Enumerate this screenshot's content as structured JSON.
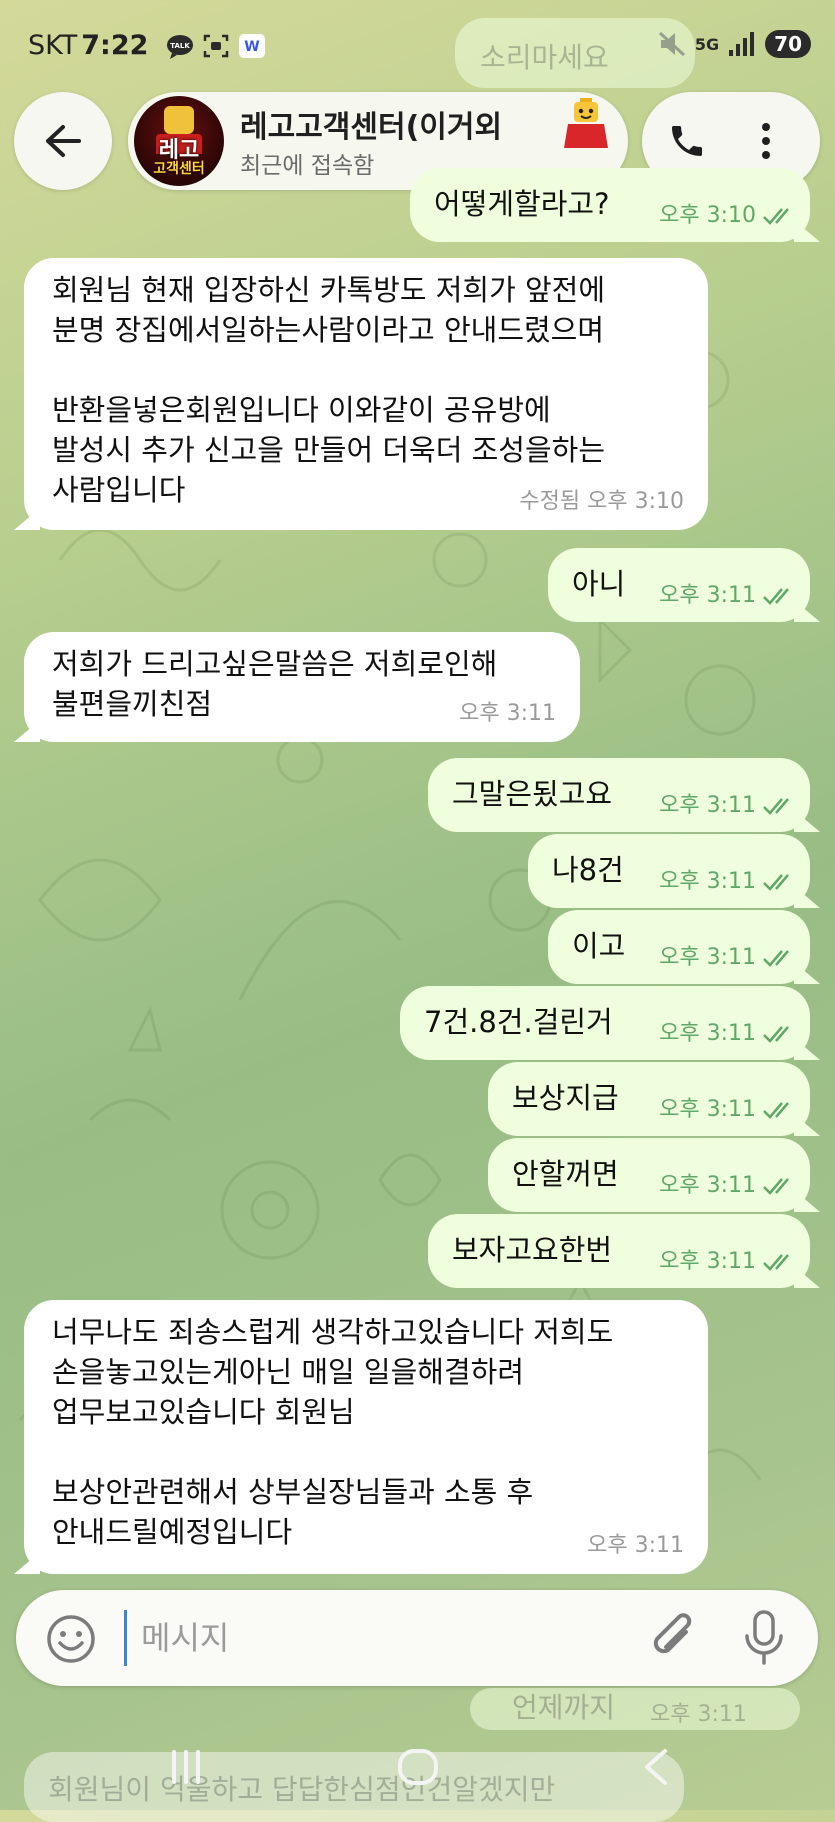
{
  "status_bar": {
    "carrier": "SKT",
    "time": "7:22",
    "network": "5G",
    "battery": "70",
    "icons": [
      "talk-icon",
      "screenshot-icon",
      "app-w-icon",
      "mute-icon",
      "signal-icon"
    ]
  },
  "header": {
    "title": "레고고객센터(이거외",
    "subtitle": "최근에 접속함",
    "avatar_line1": "레고",
    "avatar_line2": "고객센터"
  },
  "background_overlays": {
    "top_faded_text": "소리마세요",
    "bottom_faded_text1": "언제까지",
    "bottom_faded_time": "오후 3:11",
    "bottom_faded_text2": "회원님이 억울하고 답답한심점인건알겠지만"
  },
  "messages": [
    {
      "direction": "out",
      "text": "어떻게할라고?",
      "time": "오후 3:10"
    },
    {
      "direction": "in",
      "text": "회원님 현재 입장하신 카톡방도 저희가 앞전에\n분명 장집에서일하는사람이라고 안내드렸으며\n\n반환을넣은회원입니다 이와같이 공유방에\n발성시 추가 신고을 만들어 더욱더 조성을하는\n사람입니다",
      "time": "수정됨 오후 3:10"
    },
    {
      "direction": "out",
      "text": "아니",
      "time": "오후 3:11"
    },
    {
      "direction": "in",
      "text": "저희가 드리고싶은말씀은 저희로인해\n불편을끼친점",
      "time": "오후 3:11"
    },
    {
      "direction": "out",
      "text": "그말은됬고요",
      "time": "오후 3:11"
    },
    {
      "direction": "out",
      "text": "나8건",
      "time": "오후 3:11"
    },
    {
      "direction": "out",
      "text": "이고",
      "time": "오후 3:11"
    },
    {
      "direction": "out",
      "text": "7건.8건.걸린거",
      "time": "오후 3:11"
    },
    {
      "direction": "out",
      "text": "보상지급",
      "time": "오후 3:11"
    },
    {
      "direction": "out",
      "text": "안할꺼면",
      "time": "오후 3:11"
    },
    {
      "direction": "out",
      "text": "보자고요한번",
      "time": "오후 3:11"
    },
    {
      "direction": "in",
      "text": "너무나도 죄송스럽게 생각하고있습니다 저희도\n손을놓고있는게아닌 매일 일을해결하려\n업무보고있습니다 회원님\n\n보상안관련해서 상부실장님들과 소통 후\n안내드릴예정입니다",
      "time": "오후 3:11"
    }
  ],
  "input": {
    "placeholder": "메시지",
    "value": ""
  },
  "colors": {
    "outgoing_bubble": "#effedd",
    "incoming_bubble": "#ffffff",
    "read_check": "#5fa86a",
    "accent": "#3a86d4"
  }
}
